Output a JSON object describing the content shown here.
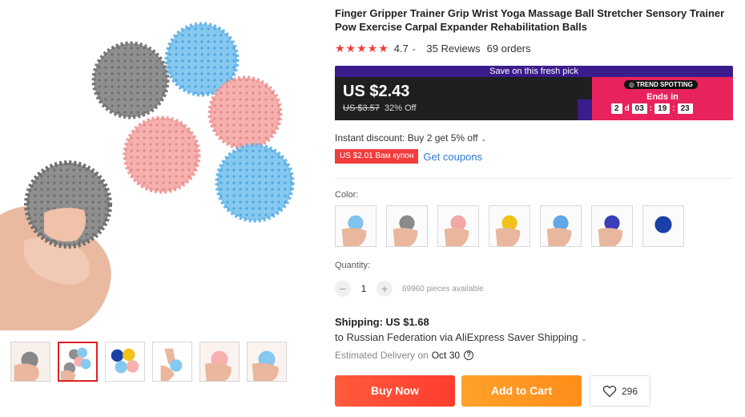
{
  "product": {
    "title": "Finger Gripper Trainer Grip Wrist Yoga Massage Ball Stretcher Sensory Trainer Pow Exercise Carpal Expander Rehabilitation Balls",
    "stars": "★★★★★",
    "rating": "4.7",
    "reviews": "35 Reviews",
    "orders": "69 orders"
  },
  "promo": {
    "banner": "Save on this fresh pick",
    "price": "US $2.43",
    "old_price": "US $3.57",
    "discount": "32% Off",
    "badge": "TREND SPOTTING",
    "ends_in": "Ends in",
    "countdown": {
      "days": "2",
      "day_unit": "d",
      "hours": "03",
      "minutes": "19",
      "seconds": "23"
    }
  },
  "discount": {
    "instant": "Instant discount: Buy 2 get 5% off",
    "coupon_tag": "US $2.01 Вам купон",
    "get_coupons": "Get coupons"
  },
  "color": {
    "label": "Color:",
    "options": [
      {
        "name": "blue",
        "color": "#7fc4ef"
      },
      {
        "name": "gray",
        "color": "#8a8a8a"
      },
      {
        "name": "pink",
        "color": "#f4a7a7"
      },
      {
        "name": "yellow",
        "color": "#f2c21a"
      },
      {
        "name": "light-blue",
        "color": "#62a8e8"
      },
      {
        "name": "purple",
        "color": "#3a3eb8"
      },
      {
        "name": "dark-blue",
        "color": "#1a3fa8"
      }
    ]
  },
  "quantity": {
    "label": "Quantity:",
    "minus": "−",
    "value": "1",
    "plus": "+",
    "available": "69960 pieces available"
  },
  "shipping": {
    "title": "Shipping: US $1.68",
    "to": "to Russian Federation via AliExpress Saver Shipping",
    "delivery_label": "Estimated Delivery on",
    "delivery_date": "Oct 30"
  },
  "actions": {
    "buy_now": "Buy Now",
    "add_to_cart": "Add to Cart",
    "wishlist_count": "296"
  },
  "colors": {
    "accent_red": "#f23c3c",
    "promo_purple": "#3b1c8c",
    "promo_pink": "#e8225c",
    "buy_now": "#ff4a36",
    "add_to_cart": "#ff9a22",
    "link_blue": "#2a7bd6"
  }
}
